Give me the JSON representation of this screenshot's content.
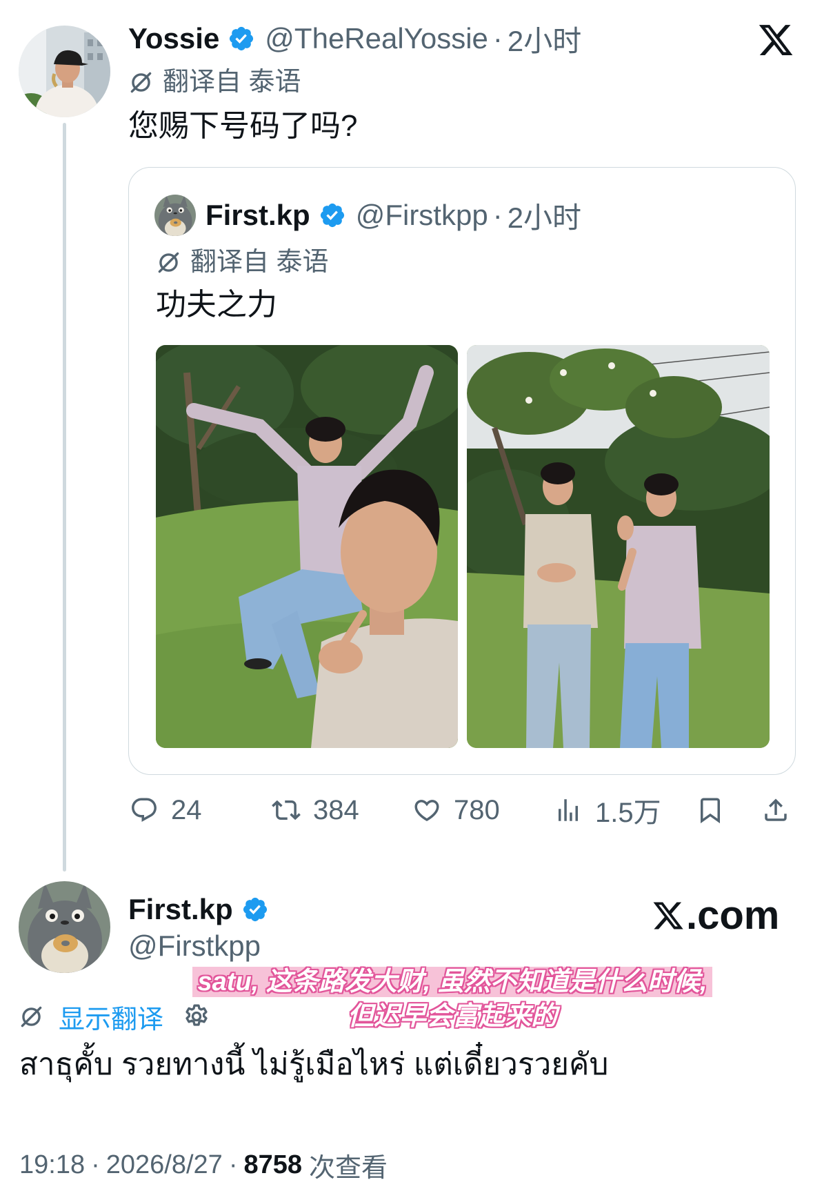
{
  "colors": {
    "text": "#0f1419",
    "secondary": "#536471",
    "accent": "#1d9bf0",
    "border": "#cfd9de",
    "verified": "#1d9bf0",
    "subtitle_band": "#f7c2d8",
    "subtitle_outline": "#e2559a"
  },
  "icons": [
    "x-logo-icon",
    "verified-badge-icon",
    "translate-icon",
    "reply-icon",
    "repost-icon",
    "like-icon",
    "views-icon",
    "bookmark-icon",
    "share-icon",
    "settings-gear-icon"
  ],
  "main_post": {
    "author": {
      "name": "Yossie",
      "handle": "@TheRealYossie",
      "separator": "·",
      "time": "2小时"
    },
    "translation_note": "翻译自 泰语",
    "text": "您赐下号码了吗?",
    "quoted_post": {
      "author": {
        "name": "First.kp",
        "handle": "@Firstkpp",
        "separator": "·",
        "time": "2小时"
      },
      "translation_note": "翻译自 泰语",
      "text": "功夫之力"
    },
    "stats": {
      "replies": "24",
      "reposts": "384",
      "likes": "780",
      "views": "1.5万"
    }
  },
  "reply_post": {
    "author": {
      "name": "First.kp",
      "handle": "@Firstkpp"
    },
    "show_translation": "显示翻译",
    "text": "สาธุคั้บ รวยทางนี้ ไม่รู้เมือไหร่ แต่เดี๋ยวรวยคับ",
    "meta": {
      "time": "19:18",
      "separator": "·",
      "date": "2026/8/27",
      "views_count": "8758",
      "views_label": "次查看"
    }
  },
  "watermark": {
    "suffix": ".com"
  },
  "subtitle": {
    "line1": "satu, 这条路发大财, 虽然不知道是什么时候,",
    "line2": "但迟早会富起来的"
  }
}
